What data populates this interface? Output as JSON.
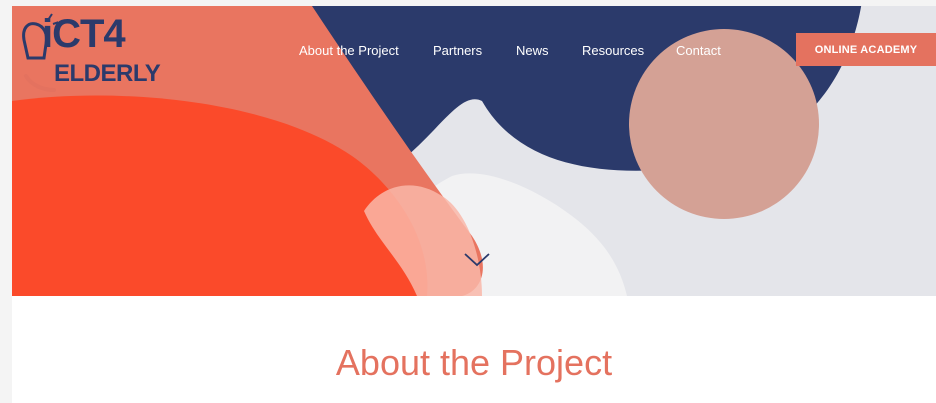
{
  "brand": {
    "logo_line1": "iCT4",
    "logo_line2": "ELDERLY"
  },
  "nav": {
    "items": [
      {
        "label": "About the Project"
      },
      {
        "label": "Partners"
      },
      {
        "label": "News"
      },
      {
        "label": "Resources"
      },
      {
        "label": "Contact"
      }
    ],
    "cta_label": "ONLINE ACADEMY"
  },
  "hero": {
    "scroll_icon": "chevron-down-icon"
  },
  "main": {
    "title": "About the Project"
  },
  "colors": {
    "accent": "#e4725f",
    "navy": "#2b3a6b",
    "orange": "#fb4a2a",
    "blush": "#d4a195",
    "background_gray": "#e4e5ea"
  }
}
